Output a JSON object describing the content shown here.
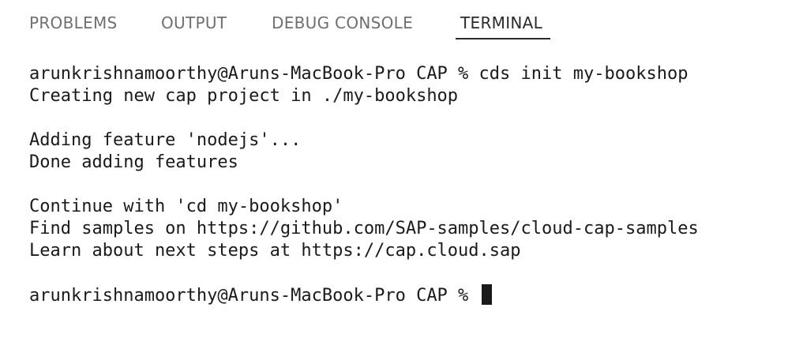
{
  "tabs": [
    {
      "label": "PROBLEMS",
      "active": false
    },
    {
      "label": "OUTPUT",
      "active": false
    },
    {
      "label": "DEBUG CONSOLE",
      "active": false
    },
    {
      "label": "TERMINAL",
      "active": true
    }
  ],
  "terminal": {
    "lines": [
      "arunkrishnamoorthy@Aruns-MacBook-Pro CAP % cds init my-bookshop",
      "Creating new cap project in ./my-bookshop",
      "",
      "Adding feature 'nodejs'...",
      "Done adding features",
      "",
      "Continue with 'cd my-bookshop'",
      "Find samples on https://github.com/SAP-samples/cloud-cap-samples",
      "Learn about next steps at https://cap.cloud.sap",
      ""
    ],
    "prompt": "arunkrishnamoorthy@Aruns-MacBook-Pro CAP % "
  },
  "colors": {
    "background": "#ffffff",
    "text": "#1a1a1a",
    "tab_inactive": "#6f6f6f",
    "tab_active": "#2b2b2b"
  }
}
